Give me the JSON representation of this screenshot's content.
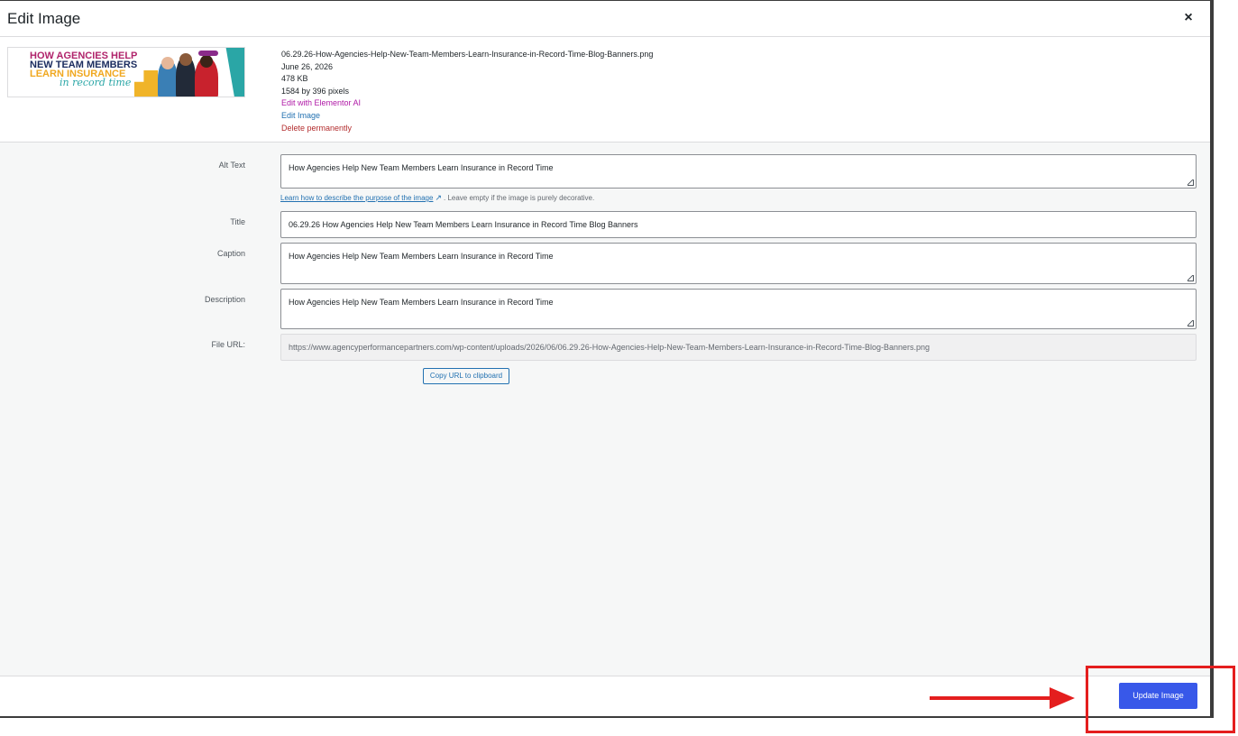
{
  "modal": {
    "title": "Edit Image",
    "close_label": "×"
  },
  "attachment": {
    "thumbnail": {
      "line1": "HOW AGENCIES HELP",
      "line2": "NEW TEAM MEMBERS",
      "line3": "LEARN INSURANCE",
      "line4": "in record time"
    },
    "filename": "06.29.26-How-Agencies-Help-New-Team-Members-Learn-Insurance-in-Record-Time-Blog-Banners.png",
    "date": "June 26, 2026",
    "file_size": "478 KB",
    "dimensions": "1584 by 396 pixels",
    "edit_ai_link": "Edit with Elementor AI",
    "edit_image_link": "Edit Image",
    "delete_link": "Delete permanently"
  },
  "form": {
    "alt_text": {
      "label": "Alt Text",
      "value": "How Agencies Help New Team Members Learn Insurance in Record Time"
    },
    "help": {
      "link_text": "Learn how to describe the purpose of the image",
      "suffix": ". Leave empty if the image is purely decorative."
    },
    "title": {
      "label": "Title",
      "value": "06.29.26 How Agencies Help New Team Members Learn Insurance in Record Time Blog Banners"
    },
    "caption": {
      "label": "Caption",
      "value": "How Agencies Help New Team Members Learn Insurance in Record Time"
    },
    "description": {
      "label": "Description",
      "value": "How Agencies Help New Team Members Learn Insurance in Record Time"
    },
    "file_url": {
      "label": "File URL:",
      "value": "https://www.agencyperformancepartners.com/wp-content/uploads/2026/06/06.29.26-How-Agencies-Help-New-Team-Members-Learn-Insurance-in-Record-Time-Blog-Banners.png"
    },
    "copy_button": "Copy URL to clipboard"
  },
  "footer": {
    "update_button": "Update Image"
  },
  "colors": {
    "primary": "#3858e9",
    "link": "#2271b1",
    "danger": "#b32d2e",
    "annotation": "#e41e1e"
  }
}
